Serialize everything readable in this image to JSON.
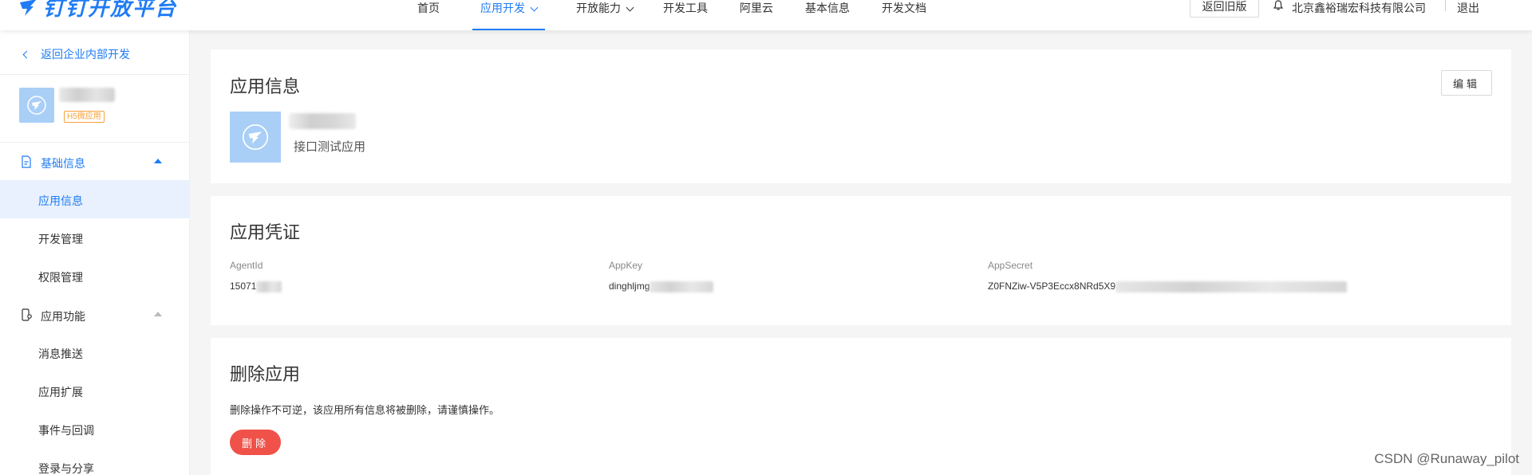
{
  "header": {
    "logo_text": "钉钉开放平台",
    "nav": [
      {
        "label": "首页"
      },
      {
        "label": "应用开发"
      },
      {
        "label": "开放能力"
      },
      {
        "label": "开发工具"
      },
      {
        "label": "阿里云"
      },
      {
        "label": "基本信息"
      },
      {
        "label": "开发文档"
      }
    ],
    "old_version_label": "返回旧版",
    "company_name": "北京鑫裕瑞宏科技有限公司",
    "logout_label": "退出",
    "accent_color": "#1f7cf5"
  },
  "sidebar": {
    "back_label": "返回企业内部开发",
    "app_badge": "H5微应用",
    "groups": [
      {
        "label": "基础信息",
        "icon": "document-icon"
      },
      {
        "label": "应用功能",
        "icon": "mobile-settings-icon"
      }
    ],
    "items": [
      {
        "label": "应用信息"
      },
      {
        "label": "开发管理"
      },
      {
        "label": "权限管理"
      },
      {
        "label": "消息推送"
      },
      {
        "label": "应用扩展"
      },
      {
        "label": "事件与回调"
      },
      {
        "label": "登录与分享"
      }
    ],
    "active_item": "应用信息"
  },
  "app_info": {
    "title": "应用信息",
    "edit_label": "编辑",
    "description": "接口测试应用"
  },
  "credentials": {
    "title": "应用凭证",
    "fields": [
      {
        "label": "AgentId",
        "value": "15071"
      },
      {
        "label": "AppKey",
        "value": "dinghljmg"
      },
      {
        "label": "AppSecret",
        "value": "Z0FNZiw-V5P3Eccx8NRd5X9"
      }
    ]
  },
  "delete_section": {
    "title": "删除应用",
    "warning": "删除操作不可逆，该应用所有信息将被删除，请谨慎操作。",
    "button_label": "删除",
    "button_color": "#f0524a"
  },
  "watermark": "CSDN @Runaway_pilot"
}
